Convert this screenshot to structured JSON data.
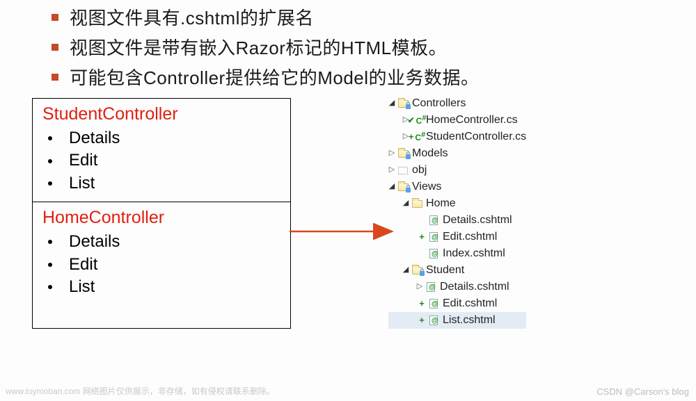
{
  "bullets": [
    "视图文件具有.cshtml的扩展名",
    "视图文件是带有嵌入Razor标记的HTML模板。",
    "可能包含Controller提供给它的Model的业务数据。"
  ],
  "boxes": [
    {
      "title": "StudentController",
      "items": [
        "Details",
        "Edit",
        "List"
      ]
    },
    {
      "title": "HomeController",
      "items": [
        "Details",
        "Edit",
        "List"
      ]
    }
  ],
  "tree": {
    "controllers": {
      "label": "Controllers",
      "children": [
        {
          "label": "HomeController.cs",
          "badge": "check"
        },
        {
          "label": "StudentController.cs",
          "badge": "plus"
        }
      ]
    },
    "models": {
      "label": "Models"
    },
    "obj": {
      "label": "obj"
    },
    "views": {
      "label": "Views",
      "home": {
        "label": "Home",
        "files": [
          {
            "label": "Details.cshtml",
            "plus": false
          },
          {
            "label": "Edit.cshtml",
            "plus": true
          },
          {
            "label": "Index.cshtml",
            "plus": false
          }
        ]
      },
      "student": {
        "label": "Student",
        "files": [
          {
            "label": "Details.cshtml",
            "plus": false,
            "tri": true
          },
          {
            "label": "Edit.cshtml",
            "plus": true
          },
          {
            "label": "List.cshtml",
            "plus": true,
            "hl": true
          }
        ]
      }
    }
  },
  "watermarks": {
    "left": "www.toymoban.com 网络图片仅供展示，非存储，如有侵权请联系删除。",
    "right": "CSDN @Carson's  blog"
  }
}
